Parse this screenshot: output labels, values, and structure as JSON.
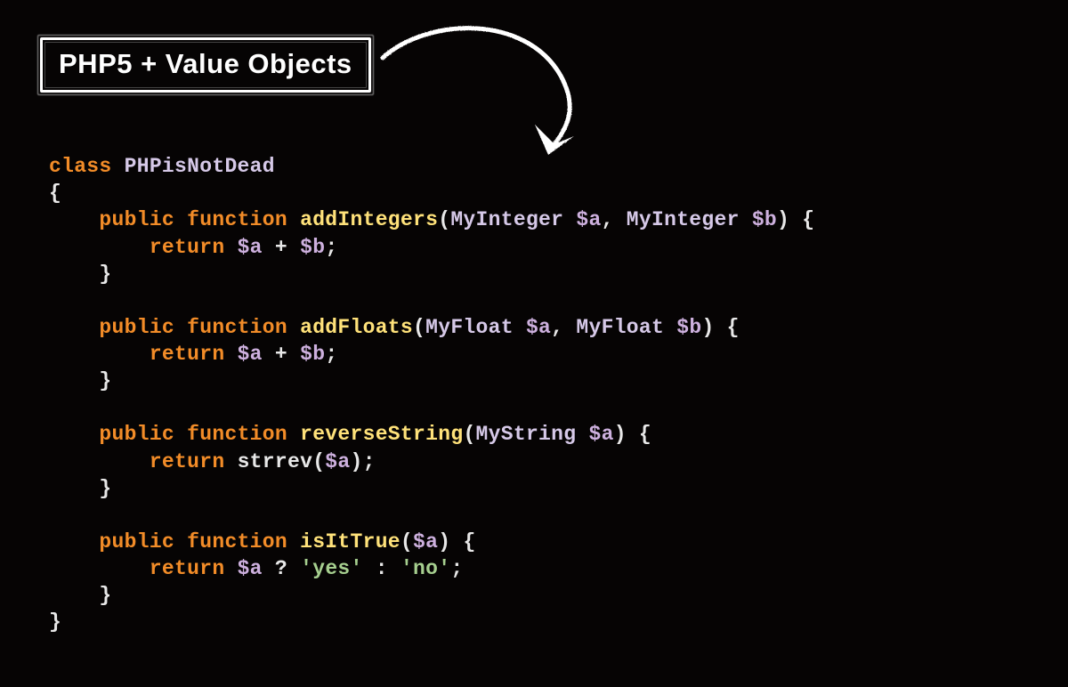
{
  "title": "PHP5 + Value Objects",
  "syntax": {
    "keywords": {
      "class": "class",
      "public": "public",
      "function": "function",
      "return": "return"
    },
    "className": "PHPisNotDead",
    "types": {
      "MyInteger": "MyInteger",
      "MyFloat": "MyFloat",
      "MyString": "MyString"
    },
    "functions": {
      "addIntegers": "addIntegers",
      "addFloats": "addFloats",
      "reverseString": "reverseString",
      "isItTrue": "isItTrue",
      "strrev": "strrev"
    },
    "vars": {
      "a": "$a",
      "b": "$b"
    },
    "strings": {
      "yes": "'yes'",
      "no": "'no'"
    },
    "punct": {
      "openBrace": "{",
      "closeBrace": "}",
      "openParen": "(",
      "closeParen": ")",
      "comma": ",",
      "plus": "+",
      "semi": ";",
      "question": "?",
      "colon": ":"
    }
  }
}
